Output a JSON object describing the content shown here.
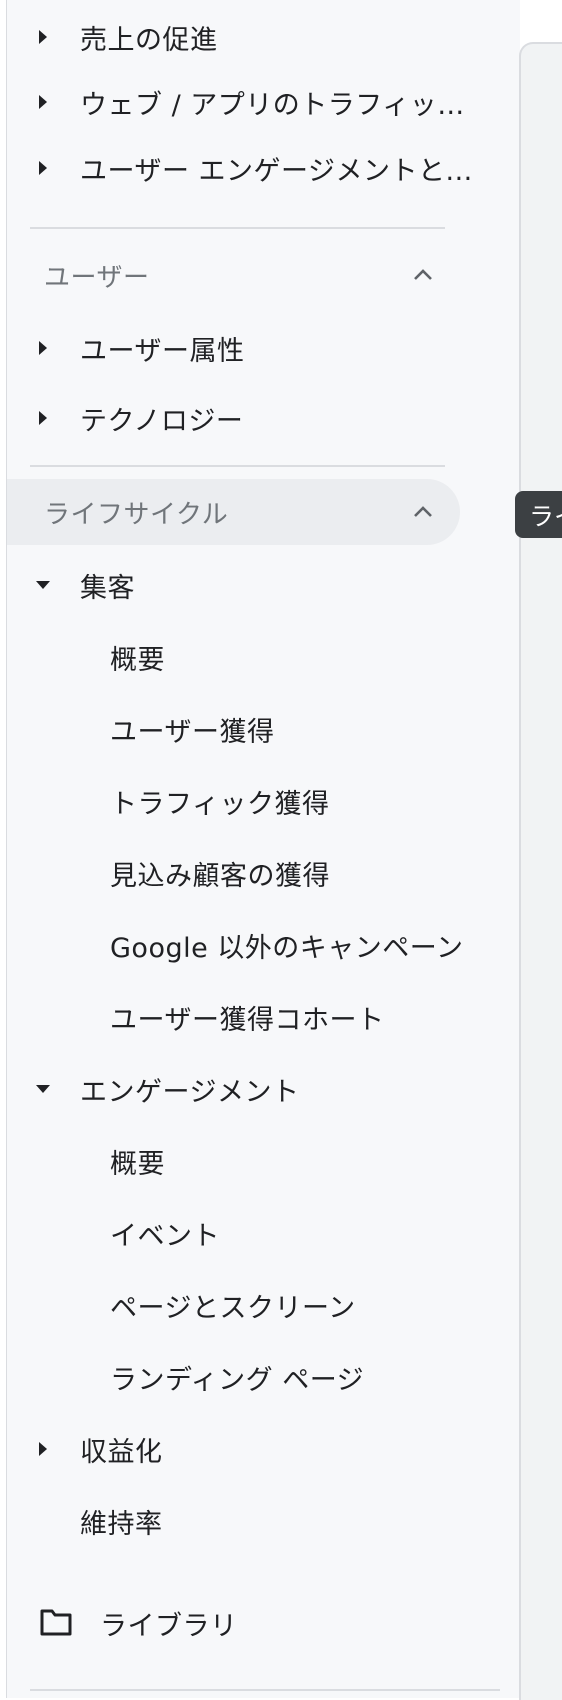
{
  "nav": {
    "items_top": [
      {
        "label": "売上の促進",
        "state": "collapsed"
      },
      {
        "label": "ウェブ / アプリのトラフィック...",
        "state": "collapsed"
      },
      {
        "label": "ユーザー エンゲージメントと...",
        "state": "collapsed"
      }
    ],
    "section_user": {
      "label": "ユーザー",
      "items": [
        {
          "label": "ユーザー属性",
          "state": "collapsed"
        },
        {
          "label": "テクノロジー",
          "state": "collapsed"
        }
      ]
    },
    "section_lifecycle": {
      "label": "ライフサイクル",
      "acquisition": {
        "label": "集客",
        "children": [
          "概要",
          "ユーザー獲得",
          "トラフィック獲得",
          "見込み顧客の獲得",
          "Google 以外のキャンペーン",
          "ユーザー獲得コホート"
        ]
      },
      "engagement": {
        "label": "エンゲージメント",
        "children": [
          "概要",
          "イベント",
          "ページとスクリーン",
          "ランディング ページ"
        ]
      },
      "monetization": {
        "label": "収益化",
        "state": "collapsed"
      },
      "retention": {
        "label": "維持率"
      }
    },
    "library": {
      "label": "ライブラリ",
      "icon": "folder-icon"
    }
  },
  "tooltip": {
    "text": "ライフサイクル"
  },
  "colors": {
    "sidebar_bg": "#f7f8fa",
    "highlight_bg": "#ebedf0",
    "text": "#202124",
    "muted": "#70757a",
    "tooltip_bg": "#3c4043"
  }
}
